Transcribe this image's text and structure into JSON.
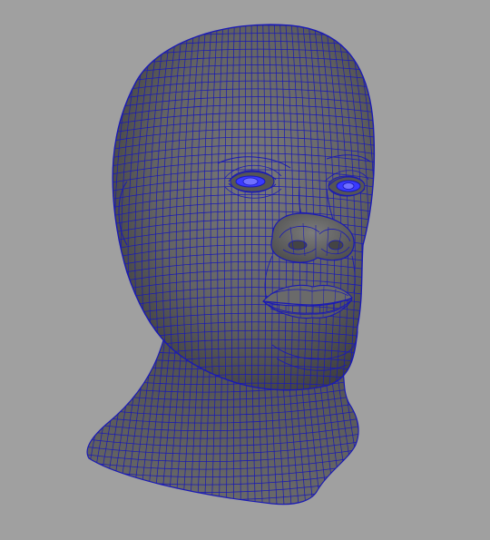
{
  "viewport": {
    "background_color": "#a0a0a0",
    "wireframe_color": "#1a1ab4",
    "shaded_surface_color": "#656565",
    "eye_highlight_color": "#5a5aff"
  },
  "model": {
    "subject": "head-wireframe-mesh",
    "display_mode": "wireframe-on-shaded"
  }
}
